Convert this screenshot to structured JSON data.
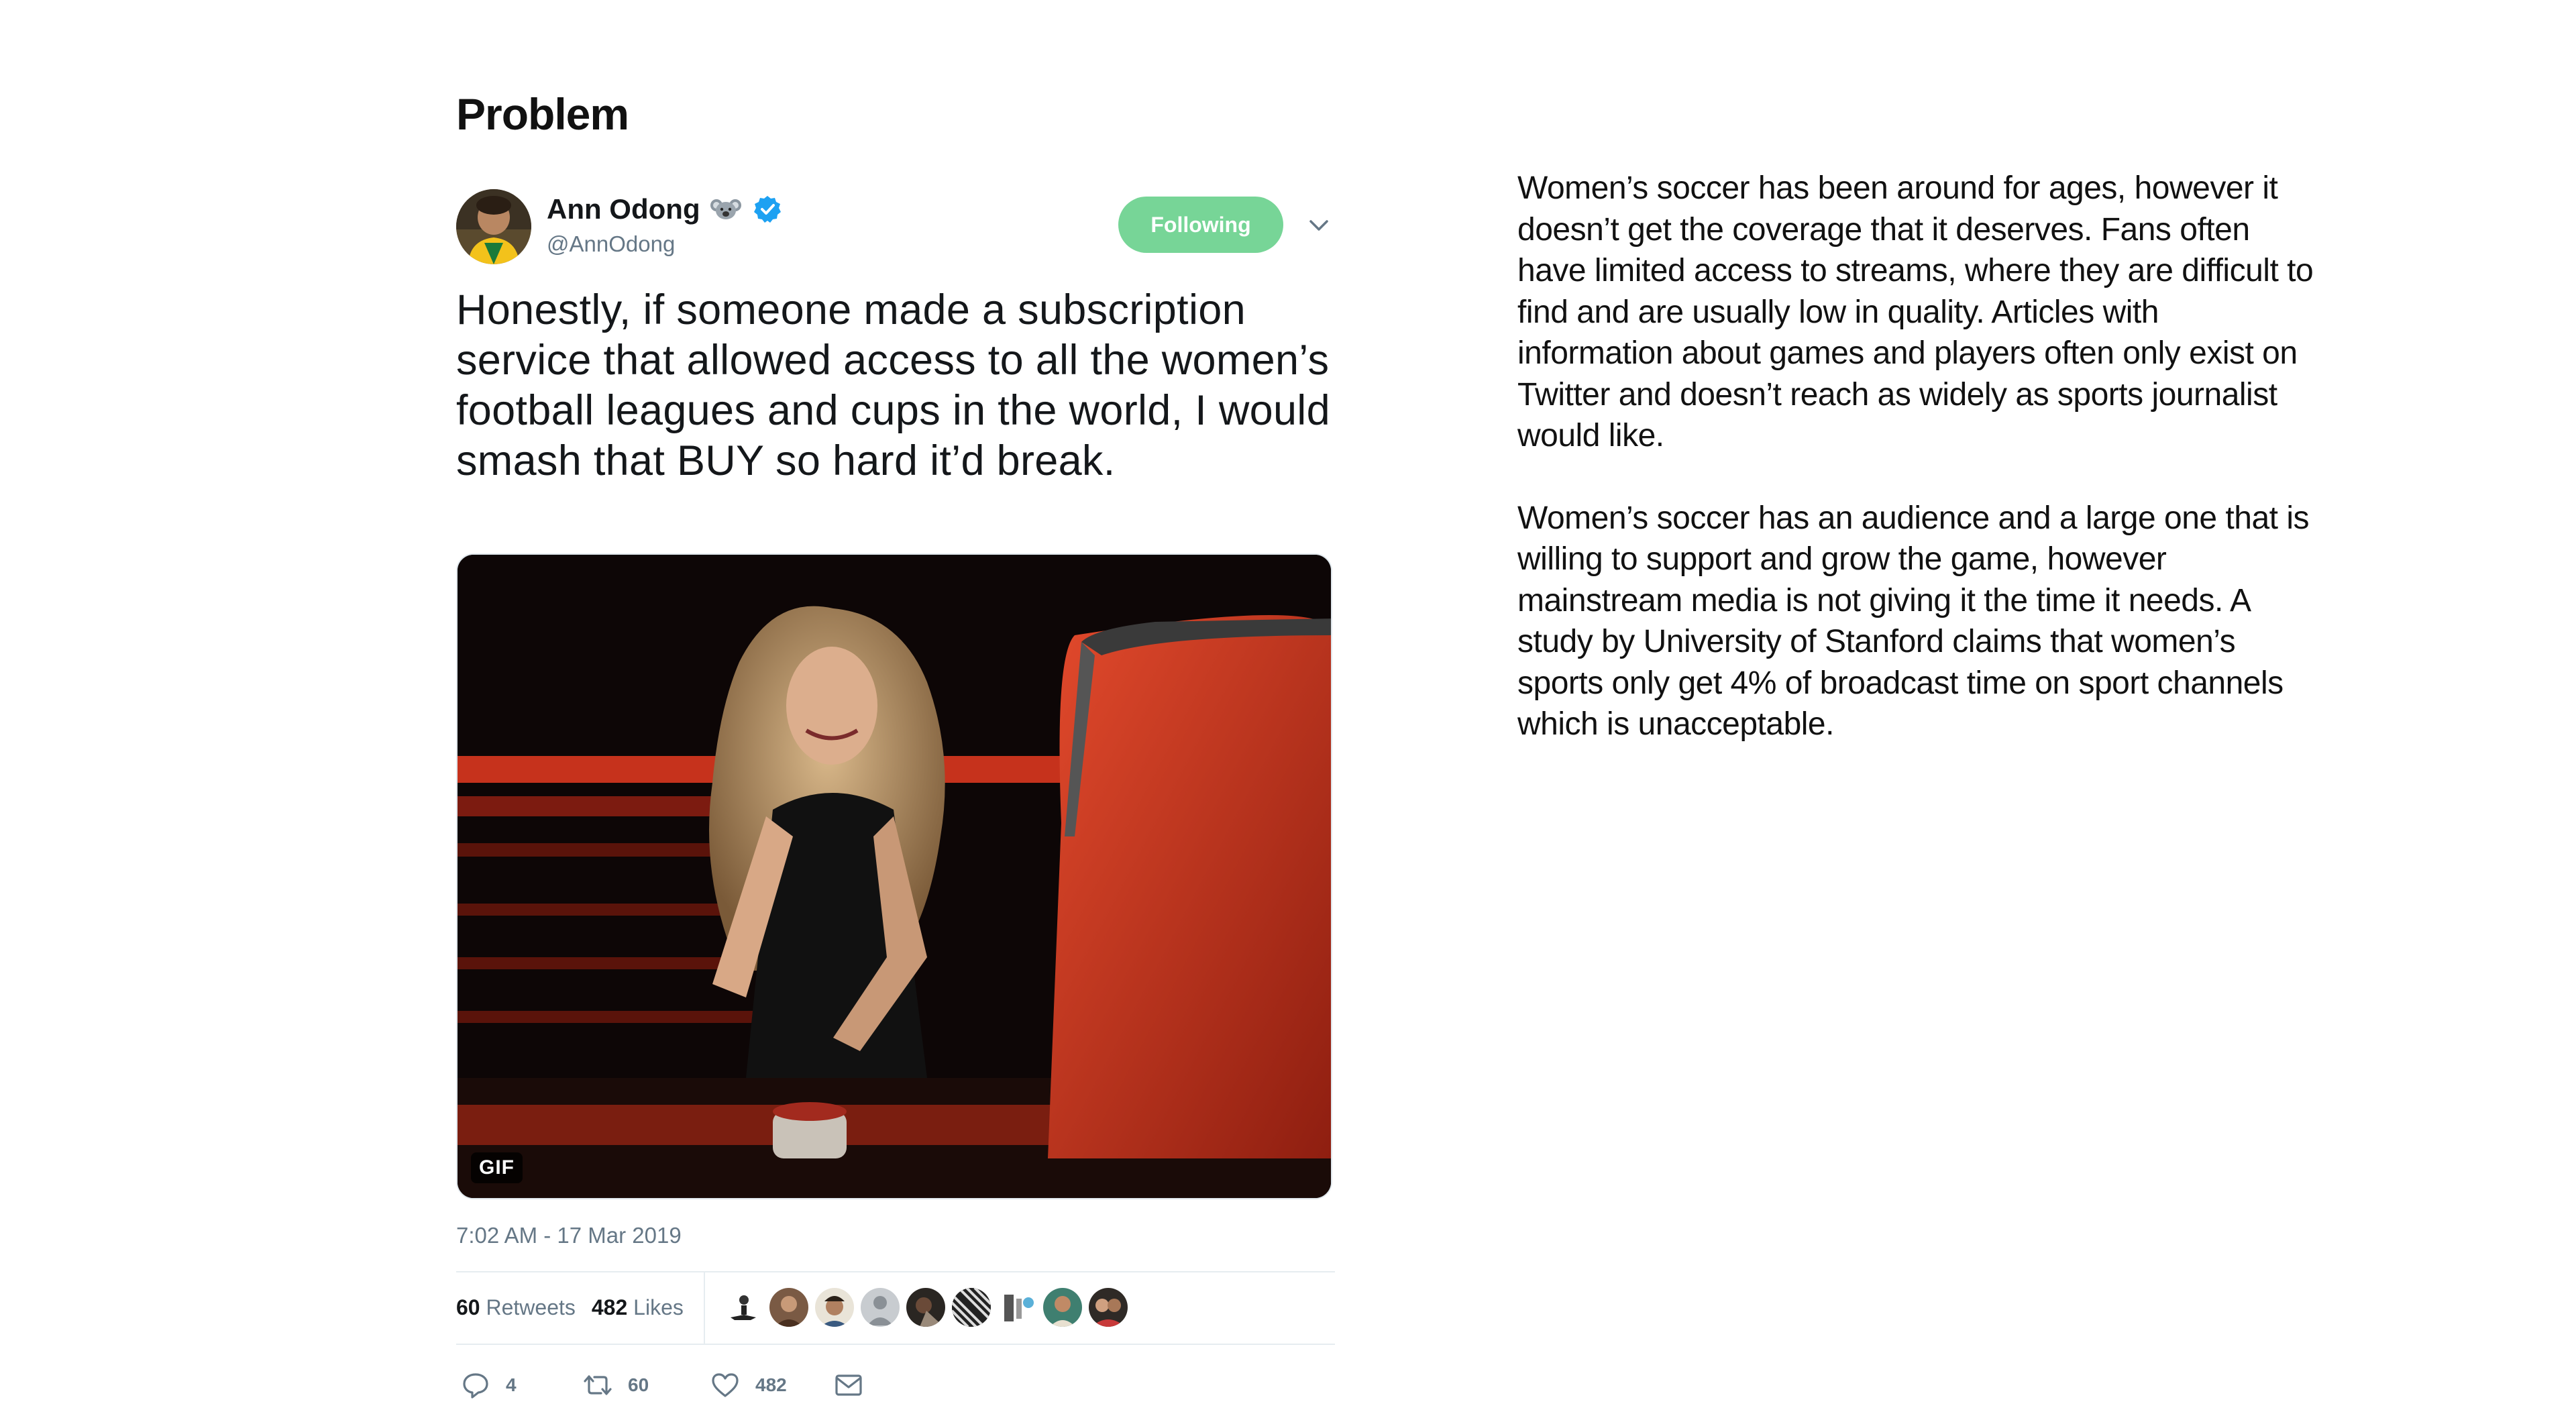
{
  "page": {
    "title": "Problem"
  },
  "tweet": {
    "author_name": "Ann Odong",
    "author_handle": "@AnnOdong",
    "follow_label": "Following",
    "text": "Honestly, if someone made a subscription service that allowed access to all the women’s football leagues and cups in the world, I would smash that BUY so hard it’d break.",
    "media_badge": "GIF",
    "timestamp": "7:02 AM - 17 Mar 2019",
    "retweets_count": "60",
    "retweets_label": "Retweets",
    "likes_count": "482",
    "likes_label": "Likes",
    "actions": {
      "reply_count": "4",
      "retweet_count": "60",
      "like_count": "482"
    },
    "icons": {
      "emoji": "koala-icon",
      "verified": "verified-badge-icon",
      "menu": "chevron-down-icon",
      "reply": "reply-icon",
      "retweet": "retweet-icon",
      "like": "heart-icon",
      "message": "direct-message-icon"
    },
    "colors": {
      "follow_button": "#77d597",
      "verified": "#1da1f2",
      "secondary_text": "#657786"
    }
  },
  "description": {
    "paragraph_1": "Women’s soccer has been around for ages, however it doesn’t get the coverage that it deserves. Fans often have limited access to streams, where they are difficult to find and are usually low in quality. Articles with information about games and players often only exist on Twitter and doesn’t reach as widely as sports journalist would like.",
    "paragraph_2": "Women’s soccer has an audience and a large one that is willing to support and grow the game, however mainstream media is not giving it the time it needs. A study by University of Stanford claims that women’s sports only get 4% of broadcast time on sport channels which is unacceptable."
  }
}
